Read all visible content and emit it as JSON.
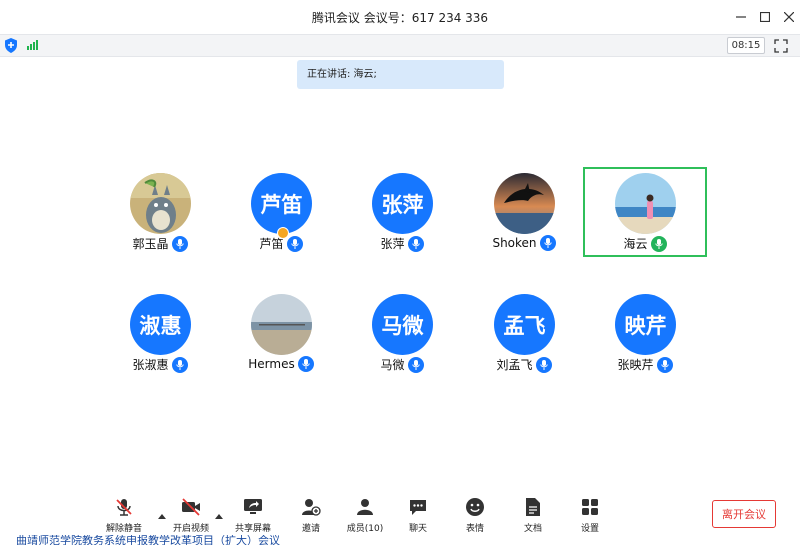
{
  "window": {
    "title": "腾讯会议 会议号：617 234 336",
    "controls": [
      "minimize-icon",
      "maximize-icon",
      "close-icon"
    ]
  },
  "status": {
    "time": "08:15",
    "icons": [
      "shield-icon",
      "signal-icon",
      "fullscreen-icon"
    ]
  },
  "speaking": {
    "text": "正在讲话: 海云;"
  },
  "participants": [
    {
      "name": "郭玉晶",
      "avatar_type": "photo",
      "avatar_icon": "totoro-photo"
    },
    {
      "name": "芦笛",
      "avatar_type": "text",
      "avatar_text": "芦笛",
      "host": true
    },
    {
      "name": "张萍",
      "avatar_type": "text",
      "avatar_text": "张萍"
    },
    {
      "name": "Shoken",
      "avatar_type": "photo",
      "avatar_icon": "dolphin-sunset-photo"
    },
    {
      "name": "海云",
      "avatar_type": "photo",
      "avatar_icon": "beach-photo",
      "speaking": true
    },
    {
      "name": "张淑惠",
      "avatar_type": "text",
      "avatar_text": "淑惠"
    },
    {
      "name": "Hermes",
      "avatar_type": "photo",
      "avatar_icon": "seaside-photo"
    },
    {
      "name": "马微",
      "avatar_type": "text",
      "avatar_text": "马微"
    },
    {
      "name": "刘孟飞",
      "avatar_type": "text",
      "avatar_text": "孟飞"
    },
    {
      "name": "张映芹",
      "avatar_type": "text",
      "avatar_text": "映芹"
    }
  ],
  "toolbar": {
    "unmute": "解除静音",
    "start_video": "开启视频",
    "share_screen": "共享屏幕",
    "invite": "邀请",
    "members": "成员(10)",
    "chat": "聊天",
    "reactions": "表情",
    "docs": "文档",
    "settings": "设置",
    "leave": "离开会议"
  },
  "colors": {
    "accent": "#1677ff",
    "speaking": "#22b35a",
    "danger": "#e53935"
  },
  "bottom_text": "曲靖师范学院教务系统申报教学改革项目（扩大）会议"
}
